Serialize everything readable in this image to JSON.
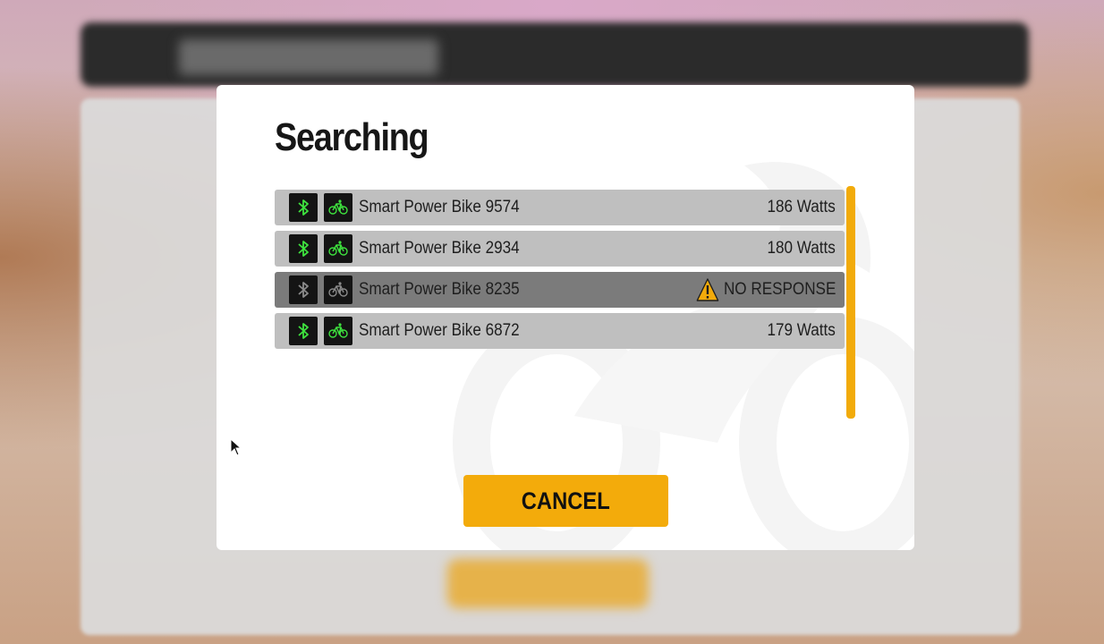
{
  "modal": {
    "title": "Searching",
    "cancel_label": "CANCEL"
  },
  "devices": [
    {
      "name": "Smart Power Bike 9574",
      "status": "186 Watts",
      "connected": true
    },
    {
      "name": "Smart Power Bike 2934",
      "status": "180 Watts",
      "connected": true
    },
    {
      "name": "Smart Power Bike 8235",
      "status": "NO RESPONSE",
      "connected": false
    },
    {
      "name": "Smart Power Bike 6872",
      "status": "179 Watts",
      "connected": true
    }
  ],
  "icons": {
    "bluetooth": "bluetooth-icon",
    "bike": "bike-icon",
    "warning": "warning-icon"
  },
  "colors": {
    "accent": "#f3ab0b",
    "active_icon": "#3ee23e",
    "inactive_icon": "#8a8a8a",
    "row_bg": "#bfbfbf",
    "row_disabled_bg": "#7b7b7b"
  }
}
